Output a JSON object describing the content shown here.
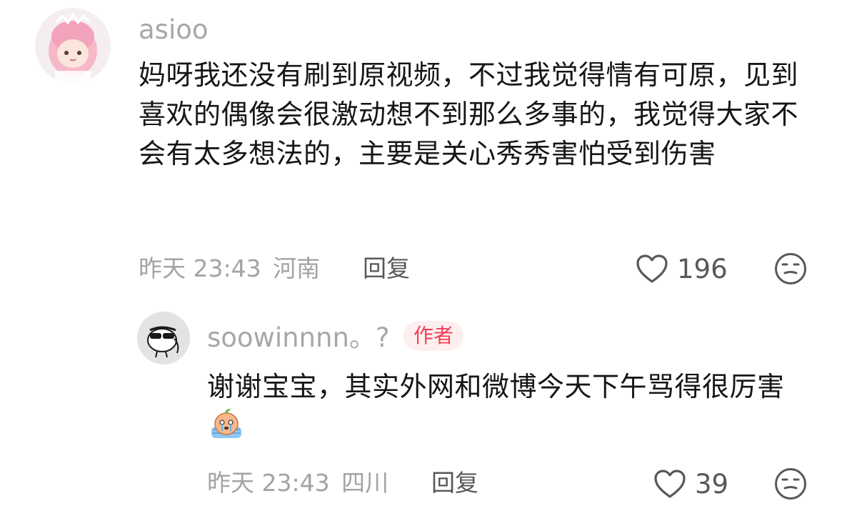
{
  "comment": {
    "username": "asioo",
    "text": "妈呀我还没有刷到原视频，不过我觉得情有可原，见到喜欢的偶像会很激动想不到那么多事的，我觉得大家不会有太多想法的，主要是关心秀秀害怕受到伤害",
    "time": "昨天 23:43",
    "location": "河南",
    "reply_label": "回复",
    "like_count": "196",
    "like_icon": "heart-outline-icon",
    "react_icon": "meh-face-icon"
  },
  "reply": {
    "username": "soowinnnn。?",
    "badge": "作者",
    "text": "谢谢宝宝，其实外网和微博今天下午骂得很厉害",
    "emoji": "crying-cartoon-emoji",
    "time": "昨天 23:43",
    "location": "四川",
    "reply_label": "回复",
    "like_count": "39",
    "like_icon": "heart-outline-icon",
    "react_icon": "meh-face-icon"
  },
  "colors": {
    "badge_text": "#f33e55",
    "badge_bg": "#fdeff0",
    "meta": "#a3a3a7",
    "username": "#a7a7ab",
    "body": "#161616"
  }
}
